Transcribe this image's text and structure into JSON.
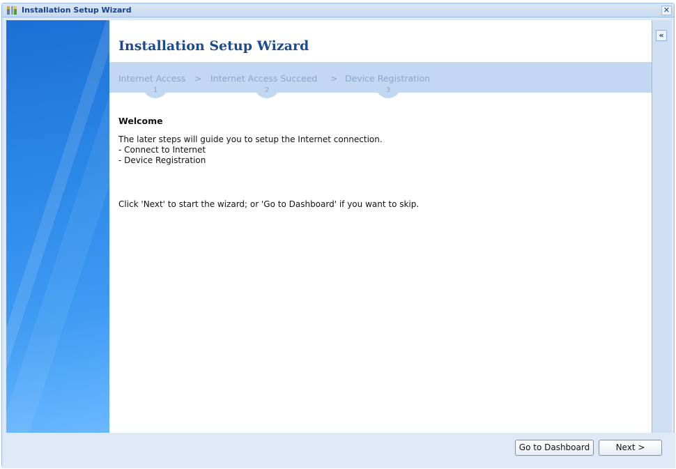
{
  "window": {
    "title": "Installation Setup Wizard",
    "close_glyph": "✕",
    "collapse_glyph": "«"
  },
  "main": {
    "heading": "Installation Setup Wizard",
    "steps": [
      {
        "label": "Internet Access",
        "number": "1"
      },
      {
        "label": "Internet Access Succeed",
        "number": "2"
      },
      {
        "label": "Device Registration",
        "number": "3"
      }
    ],
    "step_separator": ">",
    "welcome": {
      "title": "Welcome",
      "lines": [
        "The later steps will guide you to setup the Internet connection.",
        "- Connect to Internet",
        "- Device Registration"
      ],
      "instruction": "Click 'Next' to start the wizard; or 'Go to Dashboard' if you want to skip."
    }
  },
  "footer": {
    "dashboard_label": "Go to Dashboard",
    "next_label": "Next >"
  },
  "colors": {
    "accent": "#1d4a8c",
    "step_bar": "#c2d8f2",
    "sidebar": "#2a86e6"
  }
}
